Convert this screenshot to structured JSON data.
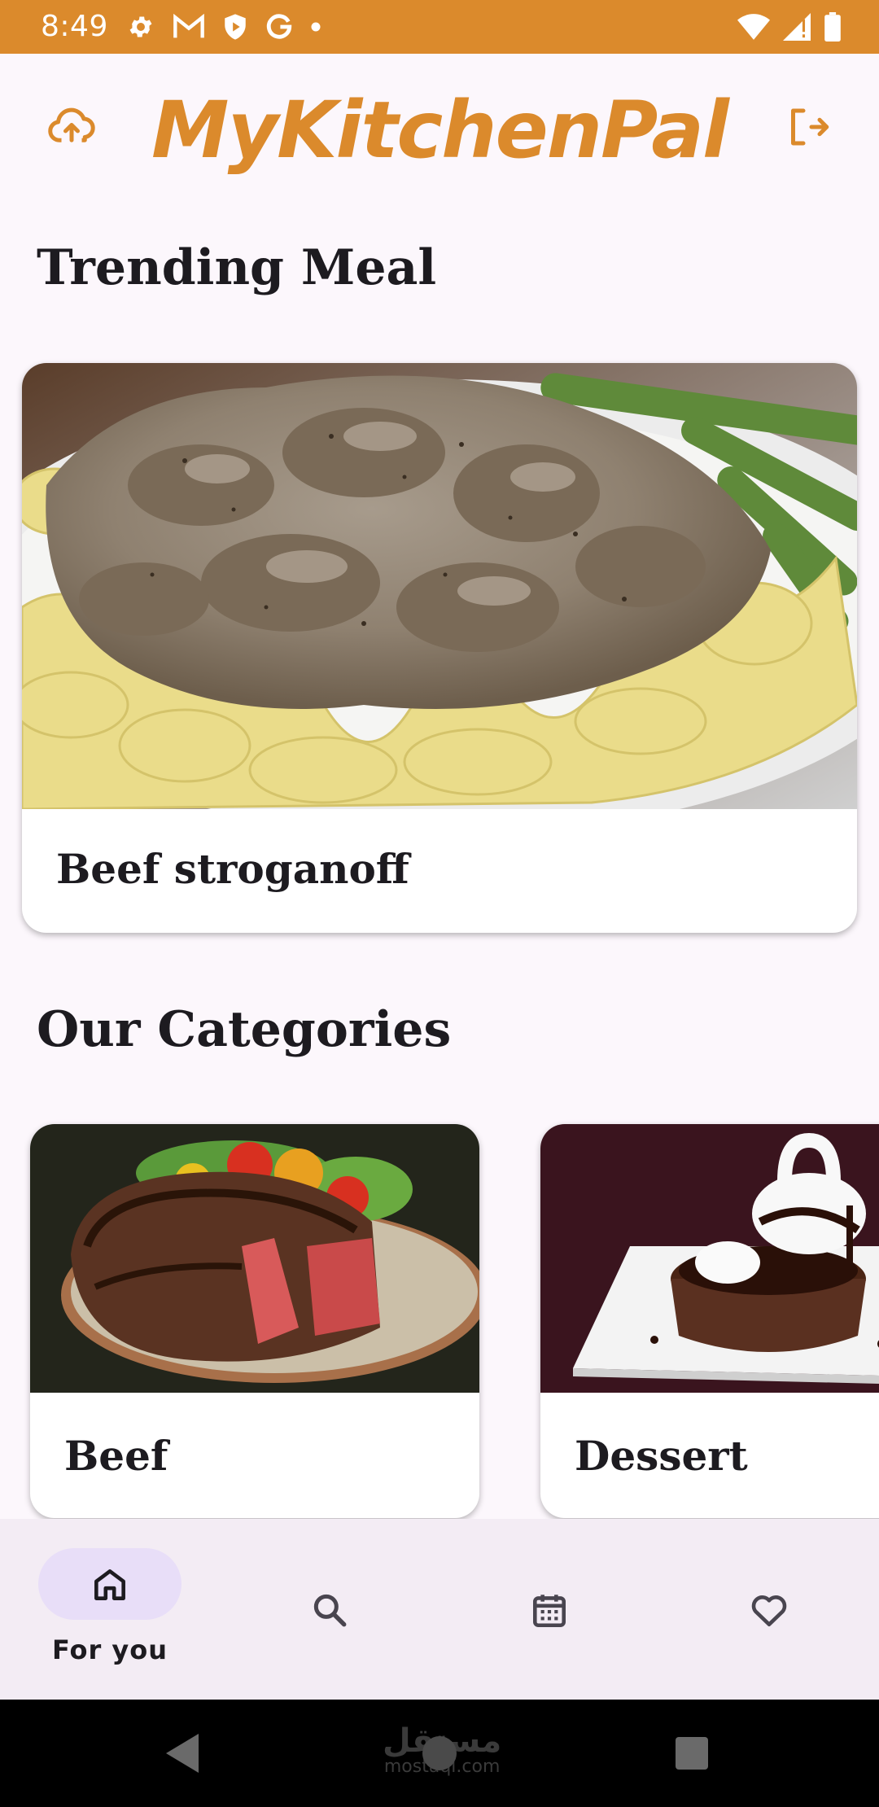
{
  "status_bar": {
    "time": "8:49",
    "icons_left": [
      "settings-icon",
      "gmail-icon",
      "shield-icon",
      "google-icon",
      "dot-icon"
    ],
    "icons_right": [
      "wifi-icon",
      "signal-icon",
      "battery-icon"
    ],
    "color": "#db8a2c"
  },
  "app_bar": {
    "title": "MyKitchenPal",
    "left_icon": "cloud-upload-icon",
    "right_icon": "logout-icon",
    "accent": "#db8a2c"
  },
  "trending": {
    "heading": "Trending Meal",
    "meal_name": "Beef stroganoff",
    "image": "beef-stroganoff-photo"
  },
  "categories": {
    "heading": "Our Categories",
    "items": [
      {
        "label": "Beef",
        "image": "steak-photo"
      },
      {
        "label": "Dessert",
        "image": "chocolate-dessert-photo"
      }
    ]
  },
  "bottom_nav": {
    "items": [
      {
        "label": "For you",
        "icon": "home-icon",
        "selected": true
      },
      {
        "label": "",
        "icon": "search-icon",
        "selected": false
      },
      {
        "label": "",
        "icon": "calendar-icon",
        "selected": false
      },
      {
        "label": "",
        "icon": "heart-icon",
        "selected": false
      }
    ],
    "pill_color": "#e8def8"
  },
  "system_nav": {
    "watermark_ar": "مستقل",
    "watermark_en": "mostaql.com"
  }
}
